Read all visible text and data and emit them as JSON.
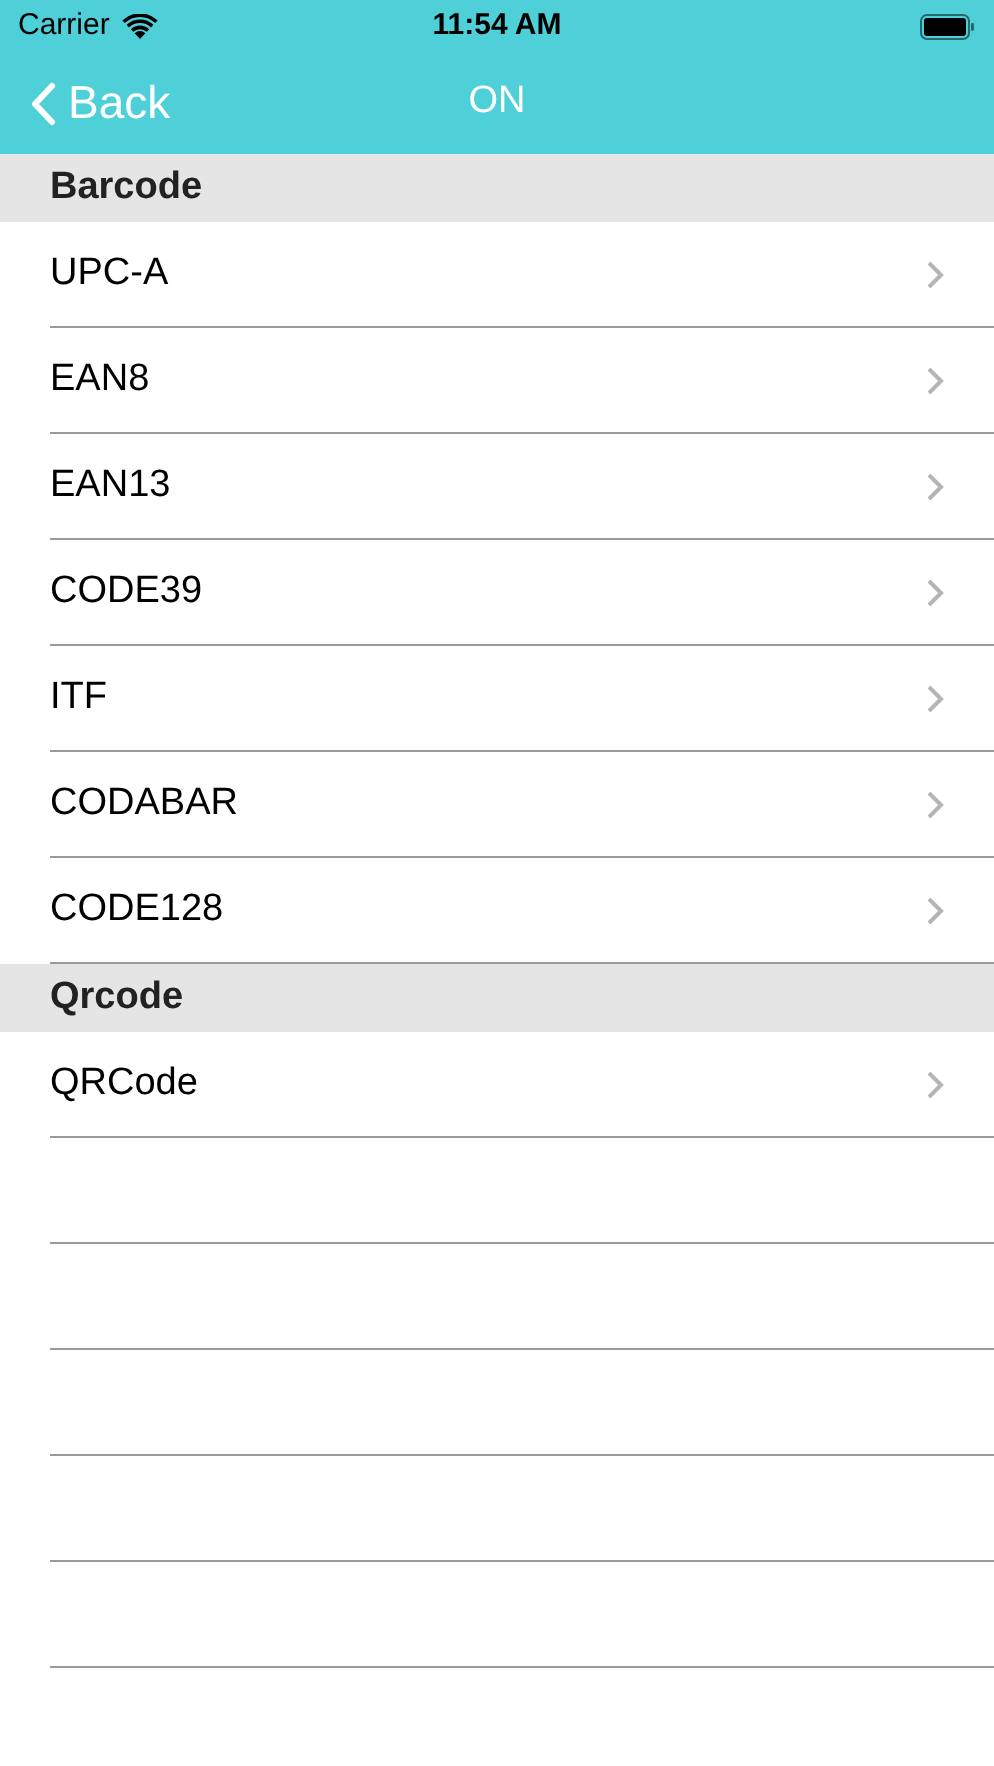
{
  "status_bar": {
    "carrier": "Carrier",
    "time": "11:54 AM"
  },
  "nav_bar": {
    "back": "Back",
    "title": "ON"
  },
  "sections": [
    {
      "title": "Barcode",
      "items": [
        "UPC-A",
        "EAN8",
        "EAN13",
        "CODE39",
        "ITF",
        "CODABAR",
        "CODE128"
      ]
    },
    {
      "title": "Qrcode",
      "items": [
        "QRCode"
      ]
    }
  ]
}
